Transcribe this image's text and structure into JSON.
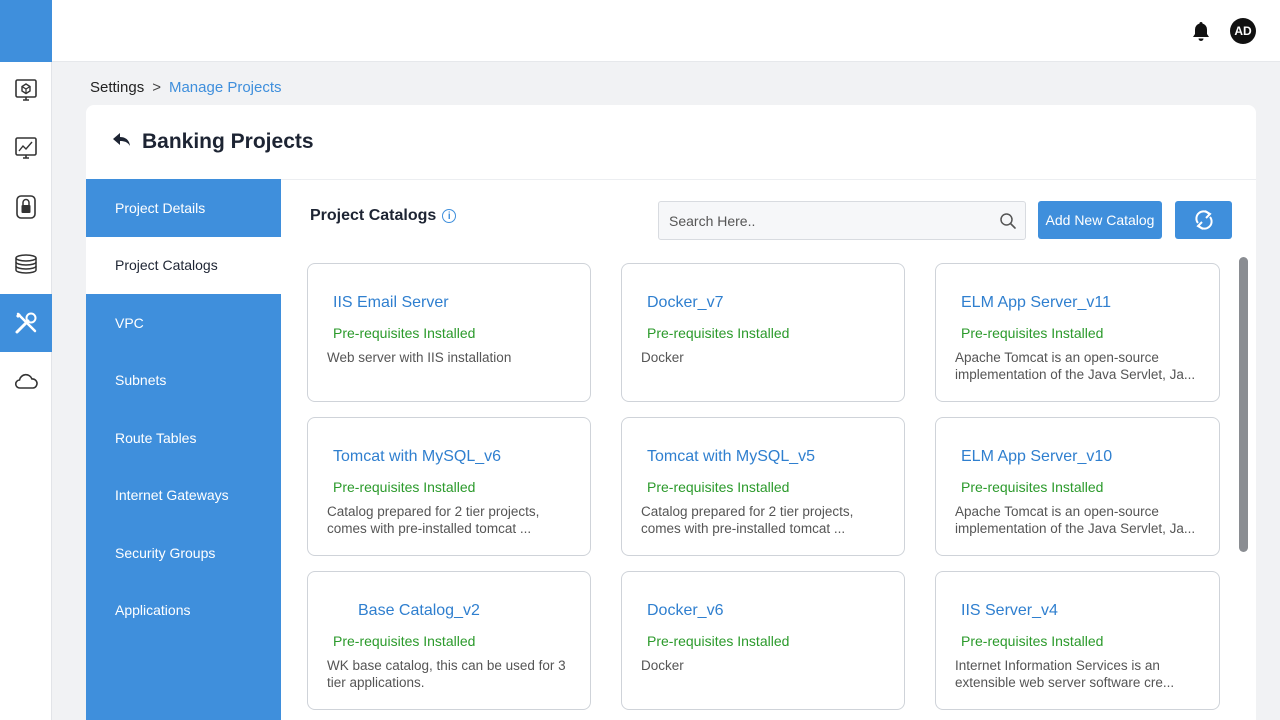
{
  "topbar": {
    "avatar_initials": "AD"
  },
  "breadcrumb": {
    "root": "Settings",
    "separator": ">",
    "current": "Manage Projects"
  },
  "panel": {
    "title": "Banking Projects"
  },
  "side_nav": {
    "items": [
      {
        "label": "Project Details"
      },
      {
        "label": "Project Catalogs"
      },
      {
        "label": "VPC"
      },
      {
        "label": "Subnets"
      },
      {
        "label": "Route Tables"
      },
      {
        "label": "Internet Gateways"
      },
      {
        "label": "Security Groups"
      },
      {
        "label": "Applications"
      }
    ],
    "active": "Project Catalogs"
  },
  "content": {
    "title": "Project Catalogs",
    "search_placeholder": "Search Here..",
    "add_button": "Add New Catalog"
  },
  "cards": [
    {
      "title": "IIS Email Server",
      "status": "Pre-requisites Installed",
      "description": "Web server with IIS installation"
    },
    {
      "title": "Docker_v7",
      "status": "Pre-requisites Installed",
      "description": "Docker"
    },
    {
      "title": "ELM App Server_v11",
      "status": "Pre-requisites Installed",
      "description": "Apache Tomcat is an open-source implementation of the Java Servlet, Ja..."
    },
    {
      "title": "Tomcat with MySQL_v6",
      "status": "Pre-requisites Installed",
      "description": "Catalog prepared for 2 tier projects, comes with pre-installed tomcat ..."
    },
    {
      "title": "Tomcat with MySQL_v5",
      "status": "Pre-requisites Installed",
      "description": "Catalog prepared for 2 tier projects, comes with pre-installed tomcat ..."
    },
    {
      "title": "ELM App Server_v10",
      "status": "Pre-requisites Installed",
      "description": "Apache Tomcat is an open-source implementation of the Java Servlet, Ja..."
    },
    {
      "title": "Base Catalog_v2",
      "status": "Pre-requisites Installed",
      "description": "WK base catalog, this can be used for 3 tier applications."
    },
    {
      "title": "Docker_v6",
      "status": "Pre-requisites Installed",
      "description": "Docker"
    },
    {
      "title": "IIS Server_v4",
      "status": "Pre-requisites Installed",
      "description": "Internet Information Services is an extensible web server software cre..."
    }
  ],
  "colors": {
    "accent": "#3f8fdc",
    "status_green": "#2b9a2b",
    "link_blue": "#2f7fcf"
  }
}
